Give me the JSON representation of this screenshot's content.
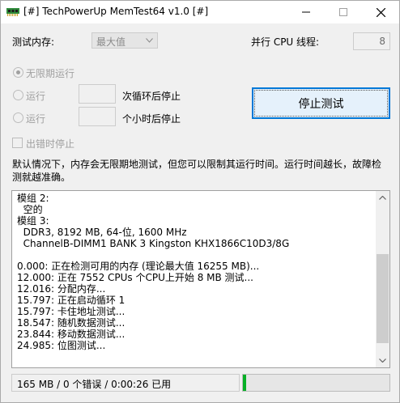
{
  "window": {
    "title": "[#] TechPowerUp MemTest64 v1.0 [#]",
    "icons": {
      "app": "memory-module-icon",
      "minimize": "minimize-icon",
      "maximize": "maximize-icon",
      "close": "close-icon"
    }
  },
  "settings": {
    "memory_label": "测试内存:",
    "memory_value": "最大值",
    "threads_label": "并行 CPU 线程:",
    "threads_value": "8",
    "run_unlimited_label": "无限期运行",
    "run_cycles_label": "运行",
    "cycles_suffix": "次循环后停止",
    "run_hours_label": "运行",
    "hours_suffix": "个小时后停止",
    "stop_on_error_label": "出错时停止",
    "stop_button_label": "停止测试"
  },
  "description": "默认情况下，内存会无限期地测试，但您可以限制其运行时间。运行时间越长，故障检测就越准确。",
  "log": {
    "lines": [
      "模组 2:",
      "  空的",
      "模组 3:",
      "  DDR3, 8192 MB, 64-位, 1600 MHz",
      "  ChannelB-DIMM1 BANK 3 Kingston KHX1866C10D3/8G",
      "",
      "0.000: 正在检测可用的内存 (理论最大值 16255 MB)...",
      "12.000: 正在 7552 CPUs 个CPU上开始 8 MB 测试...",
      "12.016: 分配内存...",
      "15.797: 正在启动循环 1",
      "15.797: 卡住地址测试...",
      "18.547: 随机数据测试...",
      "23.844: 移动数据测试...",
      "24.985: 位图测试..."
    ],
    "scroll_position": 0.82
  },
  "status": {
    "text": "165 MB / 0 个错误 / 0:00:26 已用",
    "progress_fraction": 0.02,
    "progress_color": "#06b025"
  },
  "colors": {
    "accent": "#0078d7",
    "disabled_text": "#a0a0a0"
  }
}
